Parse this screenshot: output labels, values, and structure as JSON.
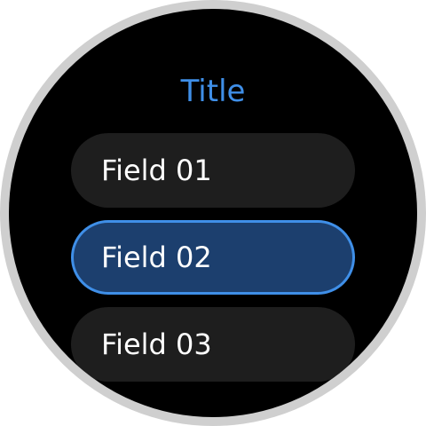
{
  "title": "Title",
  "fields": [
    {
      "label": "Field 01",
      "selected": false
    },
    {
      "label": "Field 02",
      "selected": true
    },
    {
      "label": "Field 03",
      "selected": false
    }
  ],
  "colors": {
    "accent": "#3f8fe8",
    "selected_fill": "#1c3f6e",
    "field_fill": "#1e1e1e",
    "bezel": "#cfcfcf",
    "screen": "#000000"
  }
}
